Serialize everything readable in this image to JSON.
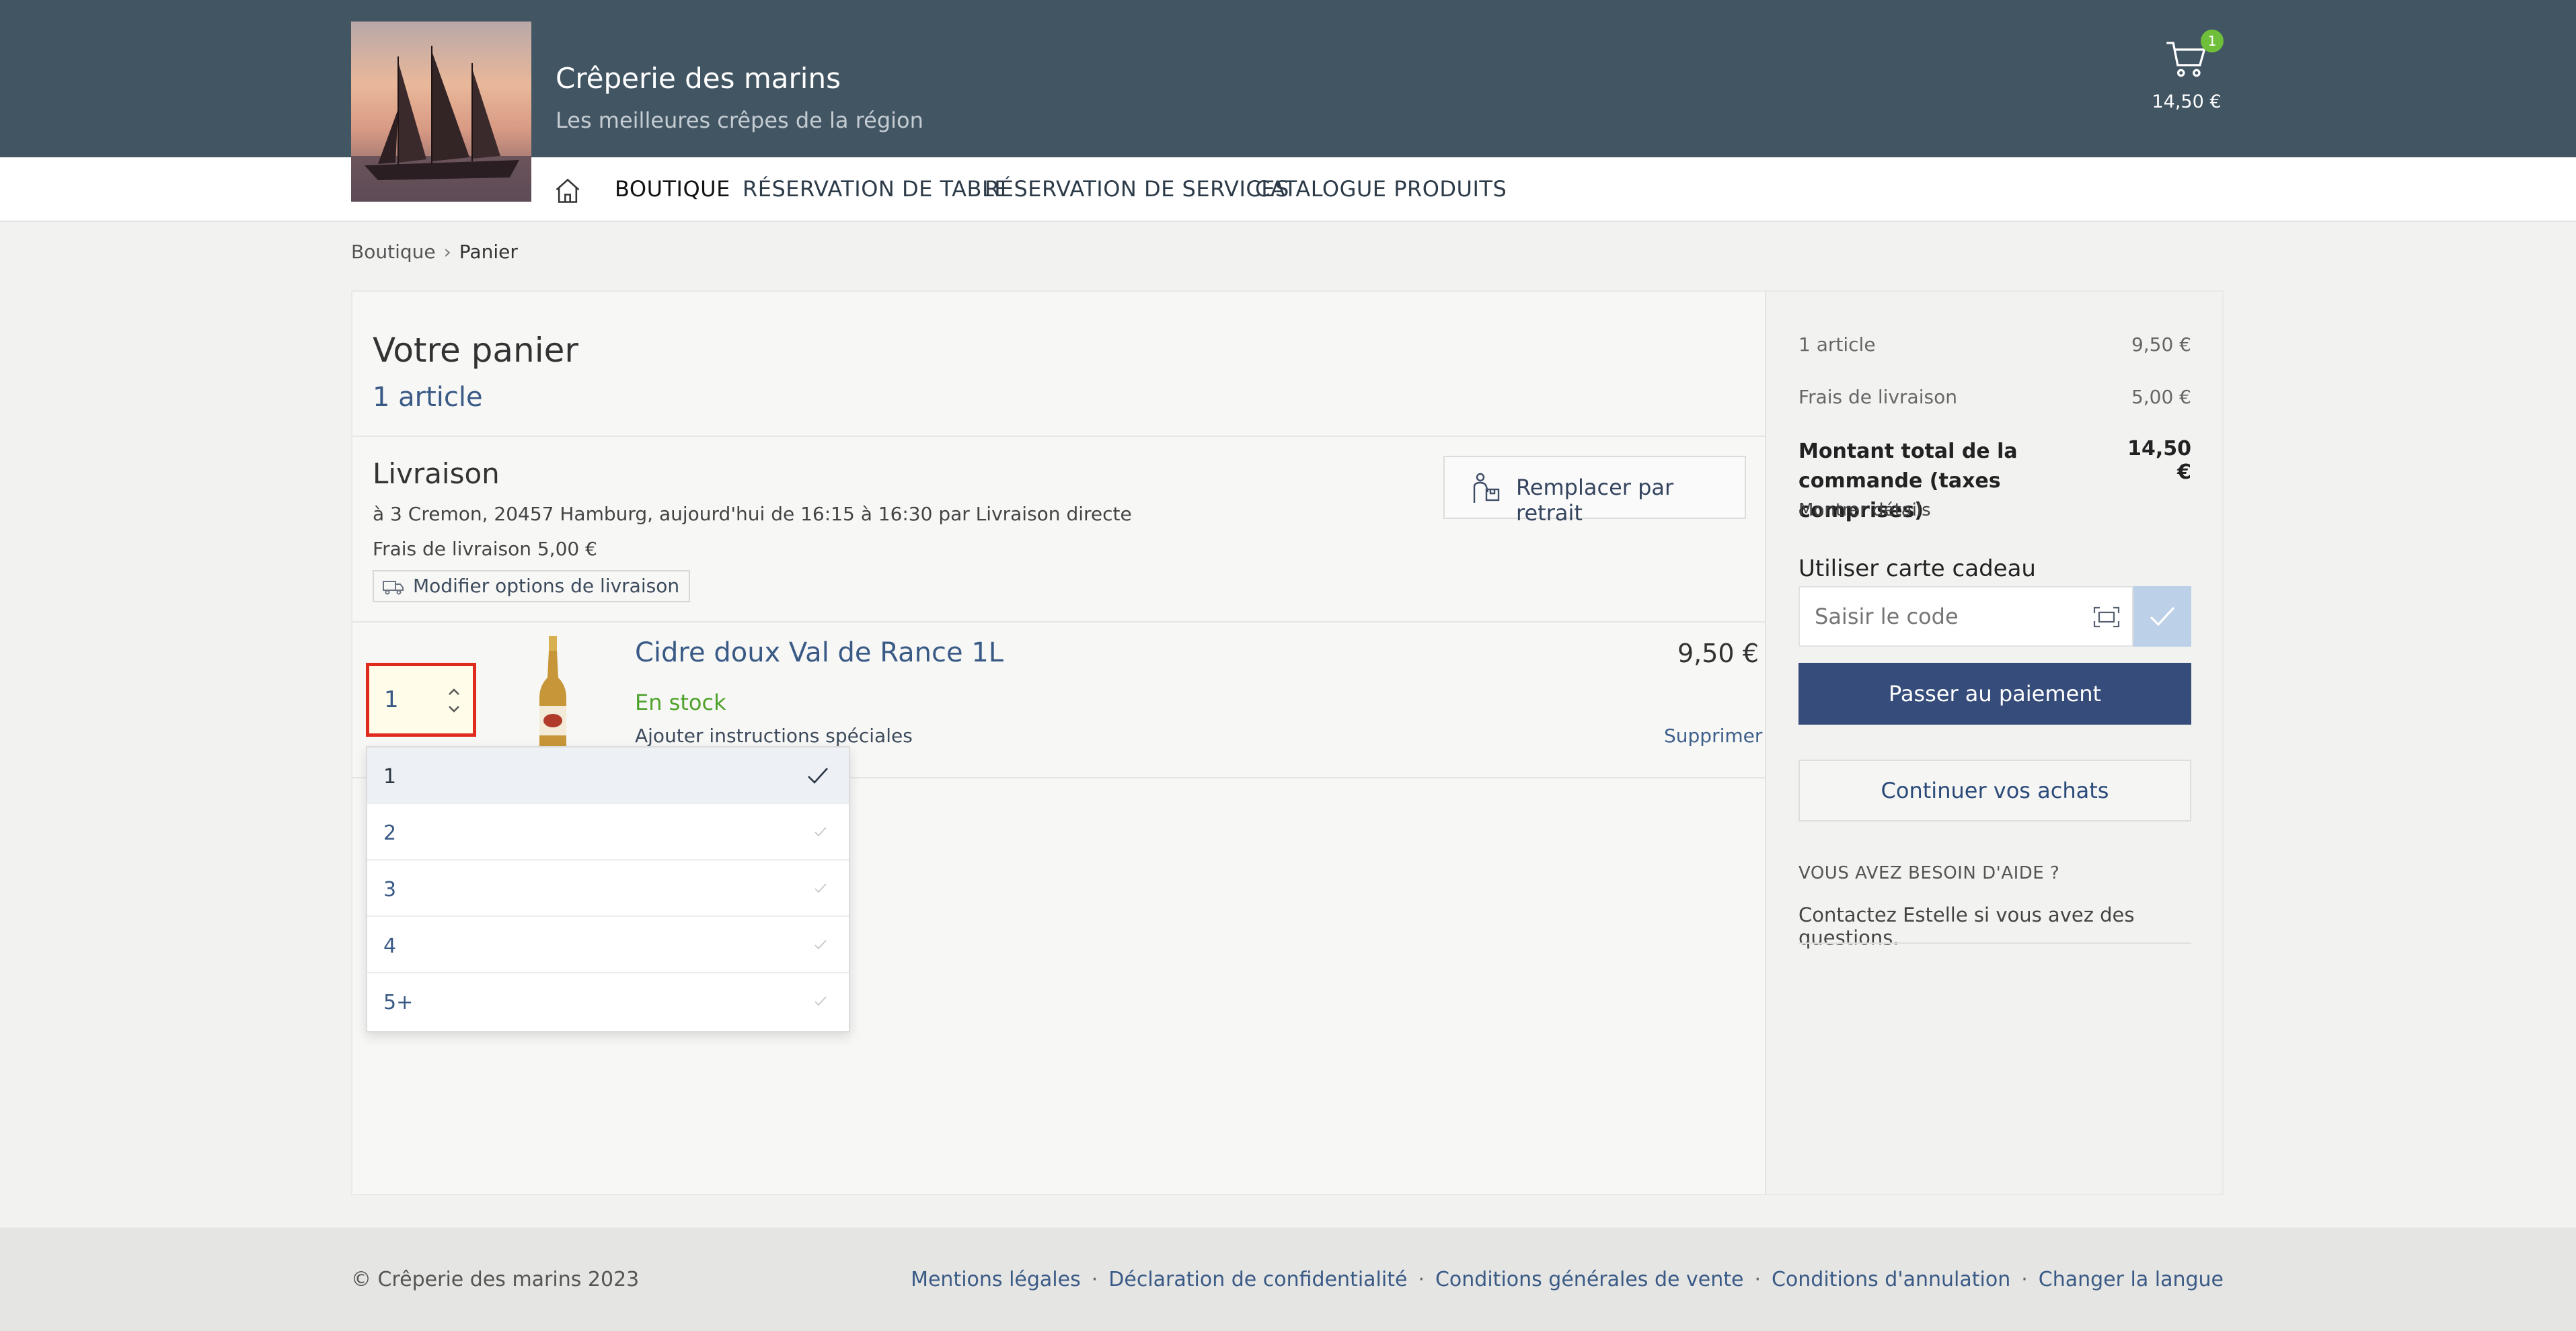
{
  "header": {
    "title": "Crêperie des marins",
    "subtitle": "Les meilleures crêpes de la région",
    "cart_count": "1",
    "cart_total": "14,50 €"
  },
  "nav": {
    "items": [
      "BOUTIQUE",
      "RÉSERVATION DE TABLE",
      "RÉSERVATION DE SERVICES",
      "CATALOGUE PRODUITS"
    ]
  },
  "breadcrumb": {
    "root": "Boutique",
    "sep": "›",
    "current": "Panier"
  },
  "cart": {
    "title": "Votre panier",
    "count_label": "1 article",
    "delivery": {
      "title": "Livraison",
      "address": "à 3 Cremon, 20457 Hamburg, aujourd'hui de 16:15 à 16:30 par Livraison directe",
      "fee": "Frais de livraison 5,00 €",
      "modify_label": "Modifier options de livraison",
      "pickup_label": "Remplacer par retrait"
    },
    "item": {
      "quantity": "1",
      "name": "Cidre doux Val de Rance 1L",
      "price": "9,50 €",
      "stock": "En stock",
      "special": "Ajouter instructions spéciales",
      "remove": "Supprimer"
    },
    "qty_options": [
      "1",
      "2",
      "3",
      "4",
      "5+"
    ],
    "qty_selected": "1"
  },
  "summary": {
    "items_label": "1 article",
    "items_value": "9,50 €",
    "shipping_label": "Frais de livraison",
    "shipping_value": "5,00 €",
    "total_label": "Montant total de la commande (taxes comprises)",
    "total_value": "14,50 €",
    "details": "Montrer détails",
    "gift_title": "Utiliser carte cadeau",
    "gift_placeholder": "Saisir le code",
    "pay_label": "Passer au paiement",
    "continue_label": "Continuer vos achats",
    "help_title": "VOUS AVEZ BESOIN D'AIDE ?",
    "help_text": "Contactez Estelle si vous avez des questions."
  },
  "footer": {
    "copyright": "© Crêperie des marins 2023",
    "links": [
      "Mentions légales",
      "Déclaration de confidentialité",
      "Conditions générales de vente",
      "Conditions d'annulation",
      "Changer la langue"
    ]
  },
  "colors": {
    "header_bg": "#425563",
    "accent_blue": "#364c7a",
    "link_blue": "#3a5a86",
    "stock_green": "#4fa22c",
    "badge_green": "#6fbf3a",
    "highlight_red": "#e02b1f"
  },
  "icons": [
    "home-icon",
    "cart-icon",
    "truck-icon",
    "pickup-icon",
    "stepper-icon",
    "check-icon",
    "scan-icon"
  ]
}
